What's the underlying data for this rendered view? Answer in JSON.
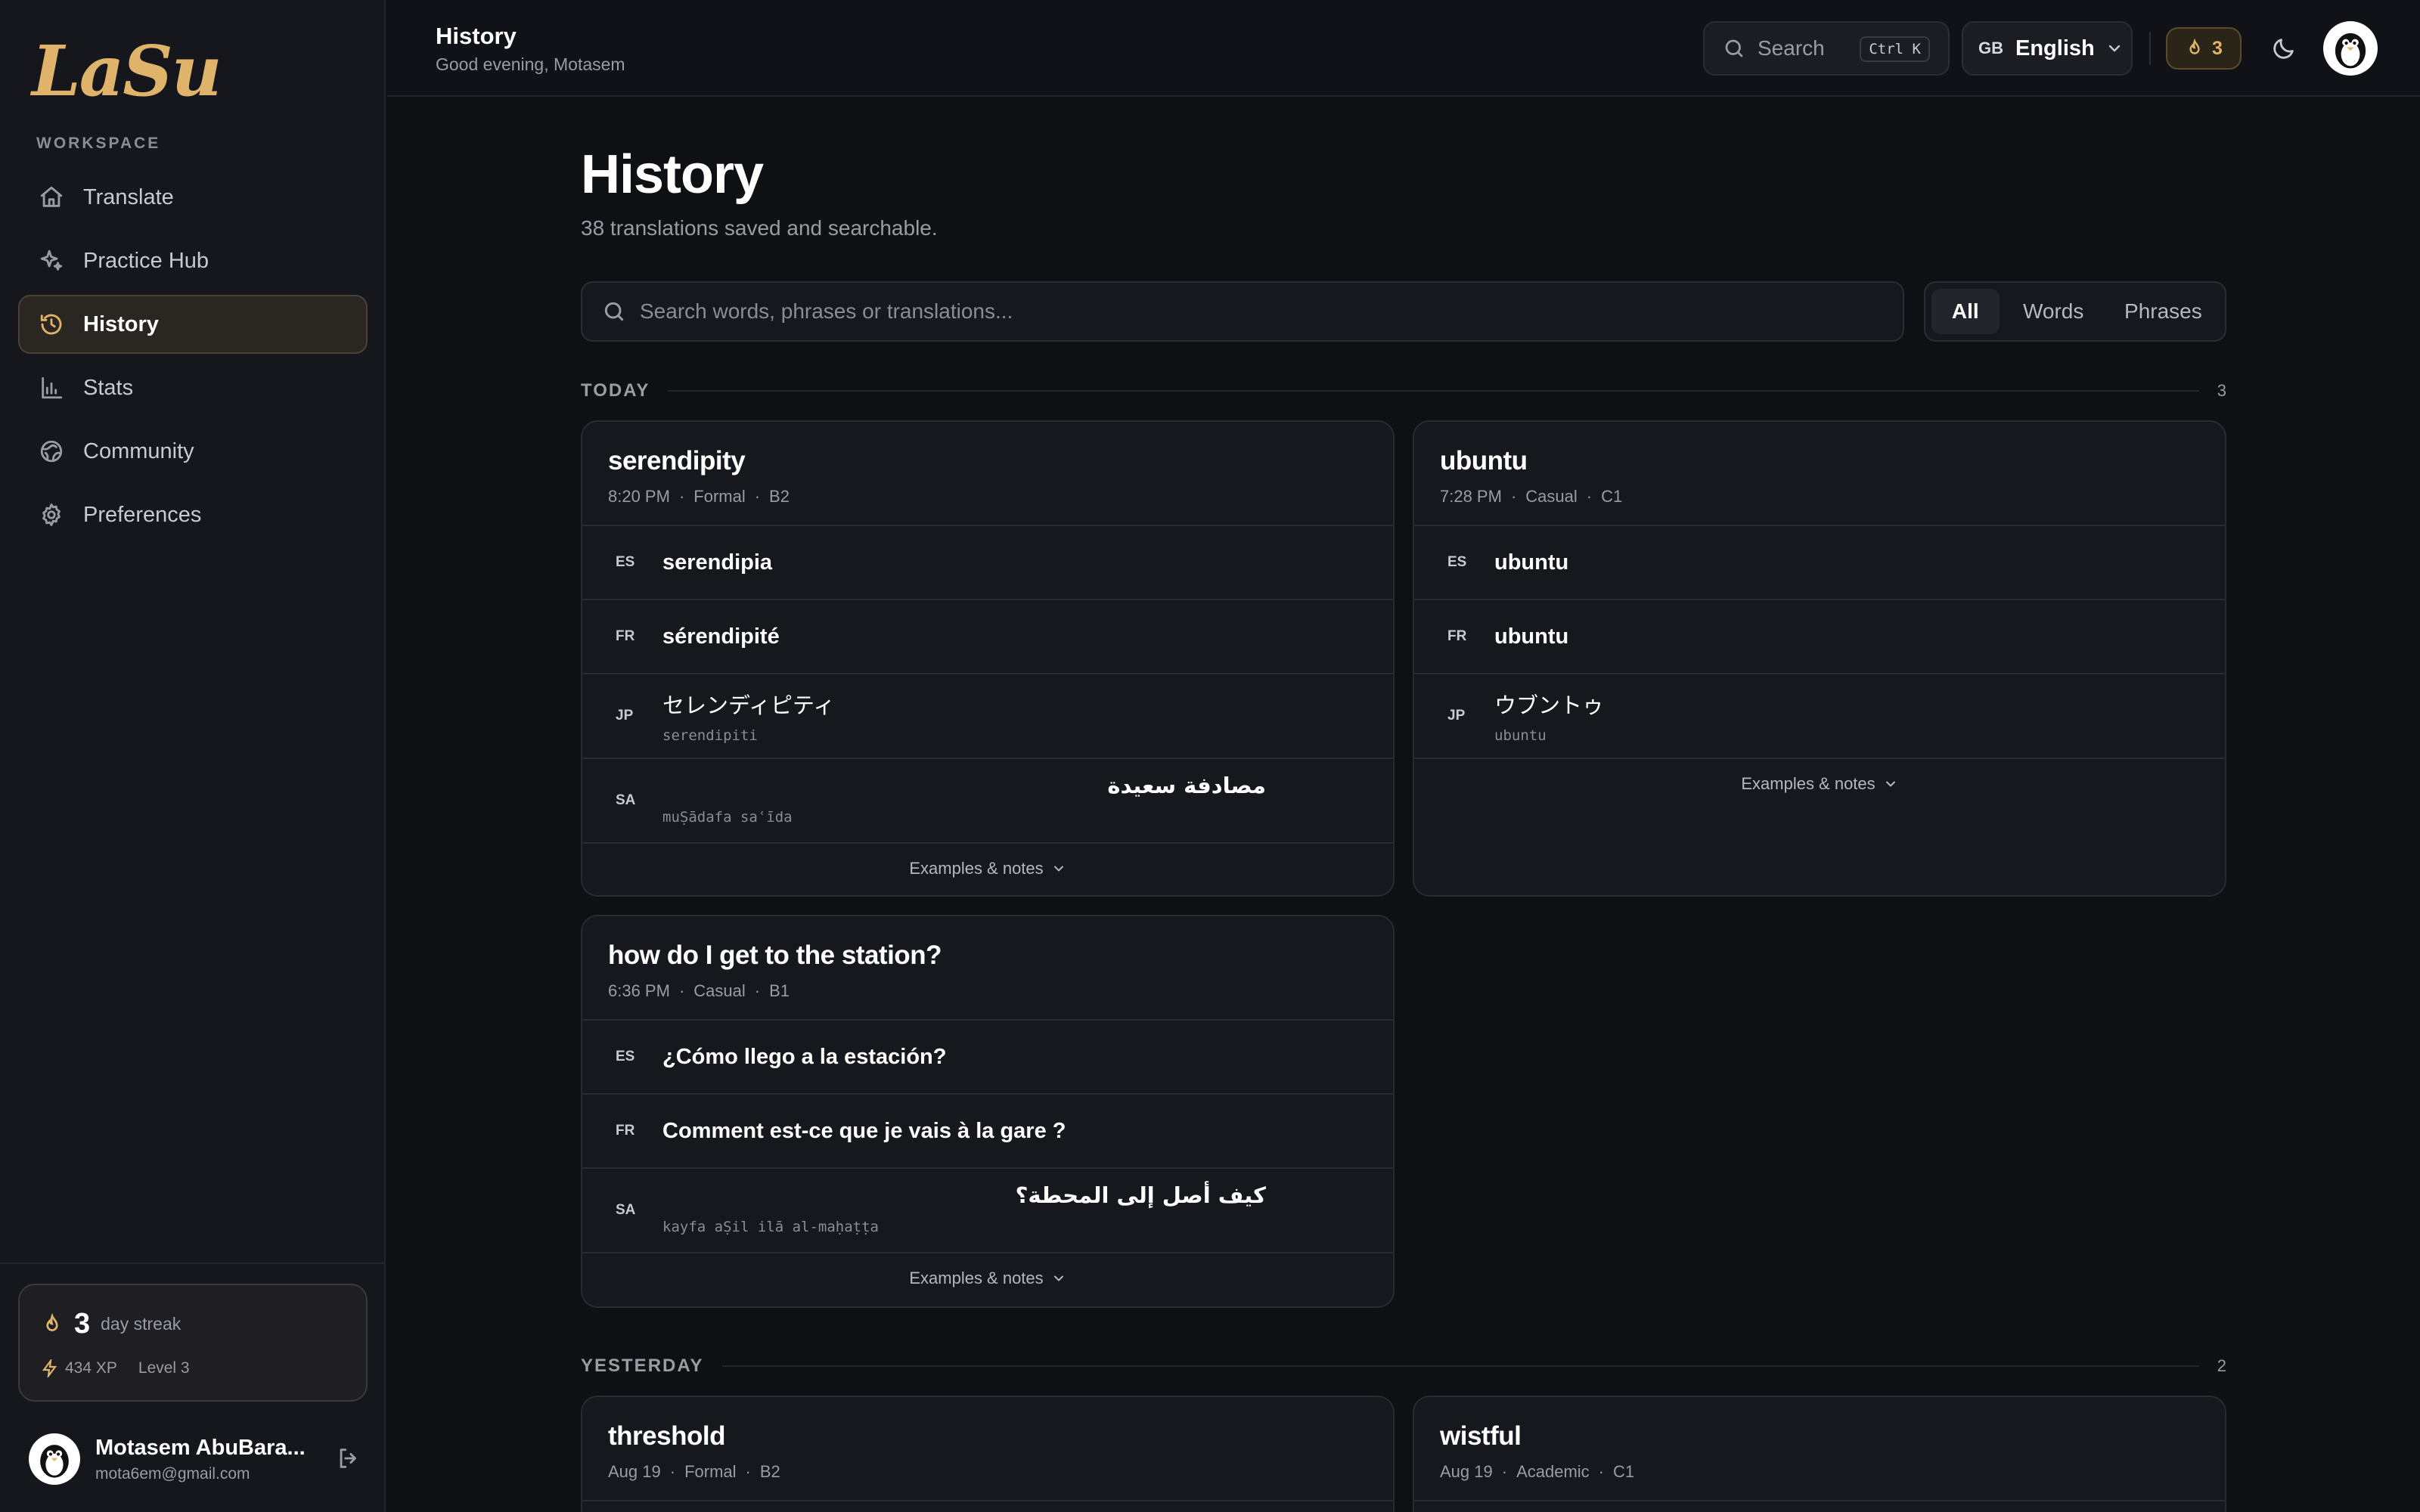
{
  "app": {
    "logo": "LaSu"
  },
  "sidebar": {
    "section_label": "WORKSPACE",
    "items": [
      {
        "label": "Translate",
        "icon": "home-icon"
      },
      {
        "label": "Practice Hub",
        "icon": "sparkle-icon"
      },
      {
        "label": "History",
        "icon": "history-icon",
        "active": true
      },
      {
        "label": "Stats",
        "icon": "bar-chart-icon"
      },
      {
        "label": "Community",
        "icon": "globe-icon"
      },
      {
        "label": "Preferences",
        "icon": "gear-icon"
      }
    ],
    "streak": {
      "days": "3",
      "label": "day streak",
      "xp": "434 XP",
      "level": "Level 3"
    },
    "user": {
      "name": "Motasem AbuBara...",
      "email": "mota6em@gmail.com"
    }
  },
  "topbar": {
    "title": "History",
    "greeting": "Good evening, Motasem",
    "search_label": "Search",
    "search_shortcut": "Ctrl K",
    "language_flag": "GB",
    "language": "English",
    "streak_count": "3"
  },
  "main": {
    "title": "History",
    "subtitle": "38 translations saved and searchable.",
    "search_placeholder": "Search words, phrases or translations...",
    "filters": [
      "All",
      "Words",
      "Phrases"
    ],
    "active_filter": "All",
    "groups": [
      {
        "label": "TODAY",
        "count": "3",
        "cards": [
          {
            "title": "serendipity",
            "time": "8:20 PM",
            "register": "Formal",
            "level": "B2",
            "translations": [
              {
                "code": "ES",
                "text": "serendipia"
              },
              {
                "code": "FR",
                "text": "sérendipité"
              },
              {
                "code": "JP",
                "text": "セレンディピティ",
                "romanization": "serendipiti"
              },
              {
                "code": "SA",
                "text": "مصادفة سعيدة",
                "romanization": "muṢādafa saʿīda"
              }
            ],
            "footer": "Examples & notes"
          },
          {
            "title": "ubuntu",
            "time": "7:28 PM",
            "register": "Casual",
            "level": "C1",
            "translations": [
              {
                "code": "ES",
                "text": "ubuntu"
              },
              {
                "code": "FR",
                "text": "ubuntu"
              },
              {
                "code": "JP",
                "text": "ウブントゥ",
                "romanization": "ubuntu"
              }
            ],
            "footer": "Examples & notes"
          },
          {
            "title": "how do I get to the station?",
            "time": "6:36 PM",
            "register": "Casual",
            "level": "B1",
            "translations": [
              {
                "code": "ES",
                "text": "¿Cómo llego a la estación?"
              },
              {
                "code": "FR",
                "text": "Comment est-ce que je vais à la gare ?"
              },
              {
                "code": "SA",
                "text": "كيف أصل إلى المحطة؟",
                "romanization": "kayfa aṢil ilā al-maḥaṭṭa"
              }
            ],
            "footer": "Examples & notes"
          }
        ]
      },
      {
        "label": "YESTERDAY",
        "count": "2",
        "cards": [
          {
            "title": "threshold",
            "time": "Aug 19",
            "register": "Formal",
            "level": "B2"
          },
          {
            "title": "wistful",
            "time": "Aug 19",
            "register": "Academic",
            "level": "C1"
          }
        ]
      }
    ]
  },
  "colors": {
    "accent": "#e0b36b",
    "background": "#0f1014",
    "card": "#17181d",
    "sidebar": "#16171d"
  }
}
